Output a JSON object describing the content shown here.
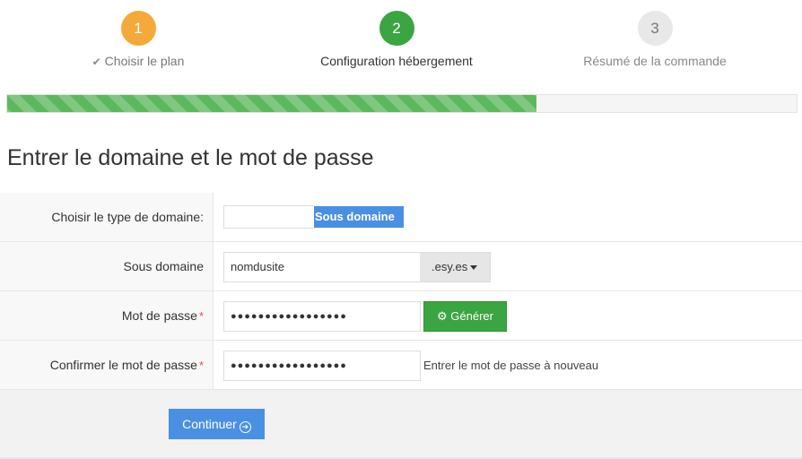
{
  "steps": [
    {
      "number": "1",
      "label": "Choisir le plan",
      "state": "done"
    },
    {
      "number": "2",
      "label": "Configuration hébergement",
      "state": "active"
    },
    {
      "number": "3",
      "label": "Résumé de la commande",
      "state": "pending"
    }
  ],
  "progress": {
    "percent": 67
  },
  "title": "Entrer le domaine et le mot de passe",
  "form": {
    "domain_type": {
      "label": "Choisir le type de domaine:",
      "selected": "Sous domaine"
    },
    "subdomain": {
      "label": "Sous domaine",
      "value": "nomdusite",
      "suffix": ".esy.es"
    },
    "password": {
      "label": "Mot de passe",
      "value": "●●●●●●●●●●●●●●●●●",
      "generate_label": "Générer"
    },
    "confirm_password": {
      "label": "Confirmer le mot de passe",
      "value": "●●●●●●●●●●●●●●●●●",
      "hint": "Entrer le mot de passe à nouveau"
    },
    "required_marker": "*"
  },
  "continue_label": "Continuer",
  "colors": {
    "step1": "#f5a93a",
    "step2": "#3aa541",
    "accent": "#4a90e2",
    "progress": "#5cb85c"
  },
  "icons": {
    "check": "check-icon",
    "gear": "gear-icon",
    "arrow": "arrow-right-circle-icon"
  }
}
